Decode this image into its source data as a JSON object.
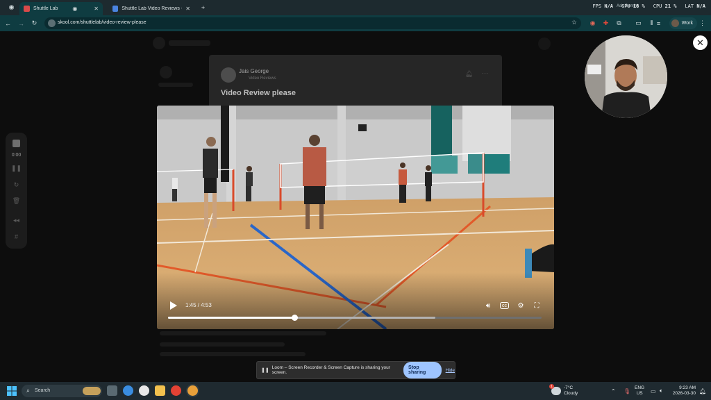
{
  "browser": {
    "tabs": [
      {
        "label": "Shuttle Lab",
        "active": true
      },
      {
        "label": "Shuttle Lab Video Reviews - Go"
      }
    ],
    "new_tab": "+",
    "url": "skool.com/shuttlelab/video-review-please",
    "profile": "Work",
    "popup_hint": "Ask Gemini",
    "stats": [
      {
        "label": "FPS",
        "value": "N/A"
      },
      {
        "label": "GPU",
        "value": "18 %"
      },
      {
        "label": "CPU",
        "value": "21 %"
      },
      {
        "label": "LAT",
        "value": "N/A"
      }
    ]
  },
  "post": {
    "author": "Jais George",
    "category": "Video Reviews",
    "title": "Video Review please"
  },
  "loom": {
    "elapsed": "0:00",
    "banner_text": "Loom – Screen Recorder & Screen Capture is sharing your screen.",
    "stop_sharing": "Stop sharing",
    "hide": "Hide"
  },
  "video": {
    "current_time": "1:45",
    "duration": "4:53",
    "played_fraction": 0.339,
    "buffered_fraction": 0.715
  },
  "taskbar": {
    "search_placeholder": "Search",
    "weather_temp": "-7°C",
    "weather_desc": "Cloudy",
    "weather_badge": "1",
    "lang": "ENG",
    "region": "US",
    "time": "9:23 AM",
    "date": "2026-03-30"
  },
  "colors": {
    "browser_toolbar": "#0f3c41",
    "loom_accent": "#9ec5ff",
    "court_floor": "#d9a868"
  }
}
